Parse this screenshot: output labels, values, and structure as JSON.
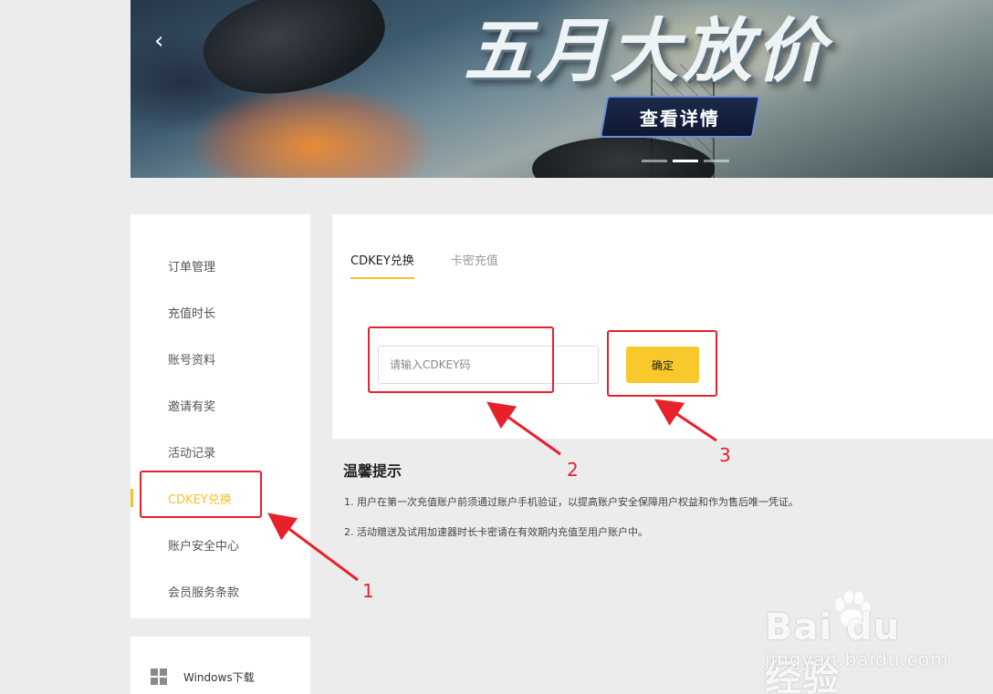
{
  "banner": {
    "headline": "五月大放价",
    "cta_label": "查看详情",
    "prev_arrow": "‹",
    "slides": 3,
    "active_slide": 2
  },
  "sidebar": {
    "items": [
      {
        "label": "订单管理"
      },
      {
        "label": "充值时长"
      },
      {
        "label": "账号资料"
      },
      {
        "label": "邀请有奖"
      },
      {
        "label": "活动记录"
      },
      {
        "label": "CDKEY兑换",
        "active": true
      },
      {
        "label": "账户安全中心"
      },
      {
        "label": "会员服务条款"
      }
    ],
    "download": {
      "label": "Windows下载",
      "icon": "windows-icon"
    }
  },
  "panel": {
    "tabs": [
      {
        "label": "CDKEY兑换",
        "active": true
      },
      {
        "label": "卡密充值",
        "active": false
      }
    ],
    "input_placeholder": "请输入CDKEY码",
    "confirm_label": "确定"
  },
  "tips": {
    "title": "温馨提示",
    "lines": [
      "1. 用户在第一次充值账户前须通过账户手机验证，以提高账户安全保障用户权益和作为售后唯一凭证。",
      "2. 活动赠送及试用加速器时长卡密请在有效期内充值至用户账户中。"
    ]
  },
  "annotations": {
    "numbers": [
      "1",
      "2",
      "3"
    ],
    "color": "#e8202a"
  },
  "watermark": {
    "brand": "Bai du 经验",
    "url": "jingyan.baidu.com"
  },
  "colors": {
    "accent": "#f5c12e",
    "button": "#f9c92b",
    "background": "#ececec"
  }
}
